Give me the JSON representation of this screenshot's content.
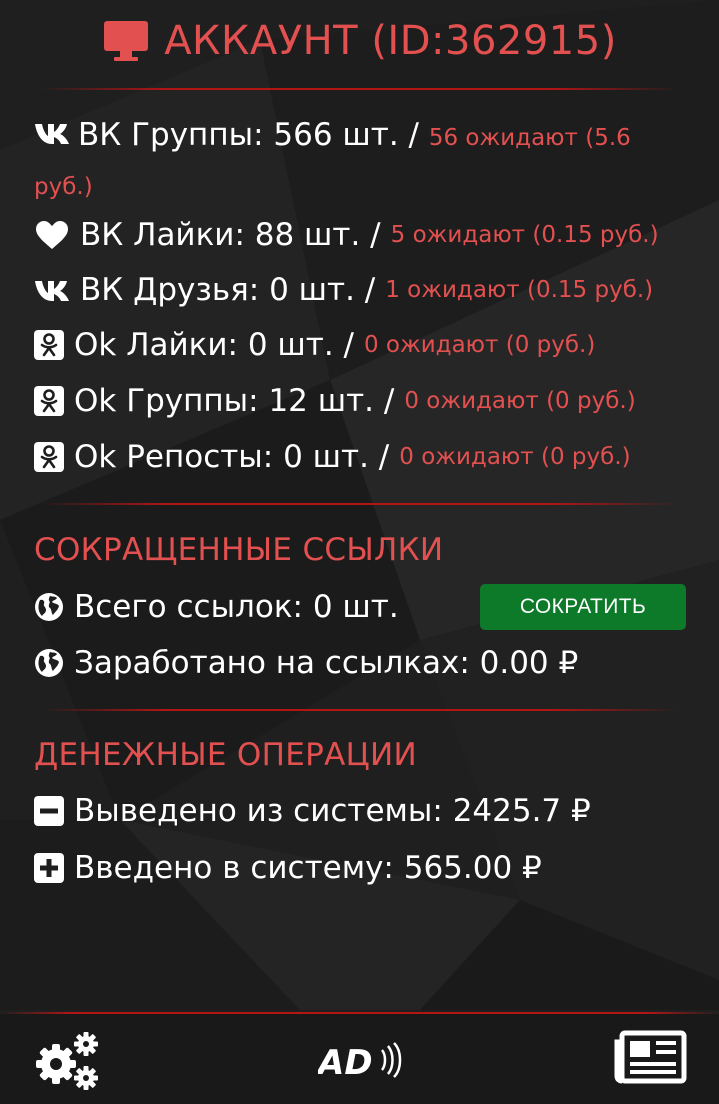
{
  "header": {
    "title": "АККАУНТ (ID:362915)",
    "icon": "monitor-icon"
  },
  "stats": {
    "vk_groups": {
      "label": "ВК Группы: 566 шт. /",
      "pending": "56 ожидают (5.6 руб.)",
      "icon": "vk-icon"
    },
    "vk_likes": {
      "label": "ВК Лайки: 88 шт. /",
      "pending": "5 ожидают (0.15 руб.)",
      "icon": "heart-icon"
    },
    "vk_friends": {
      "label": "ВК Друзья: 0 шт. /",
      "pending": "1 ожидают (0.15 руб.)",
      "icon": "vk-icon"
    },
    "ok_likes": {
      "label": "Ok Лайки: 0 шт. /",
      "pending": "0 ожидают (0 руб.)",
      "icon": "odnoklassniki-icon"
    },
    "ok_groups": {
      "label": "Ok Группы: 12 шт. /",
      "pending": "0 ожидают (0 руб.)",
      "icon": "odnoklassniki-icon"
    },
    "ok_reposts": {
      "label": "Ok Репосты: 0 шт. /",
      "pending": "0 ожидают (0 руб.)",
      "icon": "odnoklassniki-icon"
    }
  },
  "links": {
    "title": "СОКРАЩЕННЫЕ ССЫЛКИ",
    "total": "Всего ссылок: 0 шт.",
    "earned": "Заработано на ссылках: 0.00 ₽",
    "shorten_button": "СОКРАТИТЬ",
    "icon": "globe-icon"
  },
  "money": {
    "title": "ДЕНЕЖНЫЕ ОПЕРАЦИИ",
    "withdrawn": "Выведено из системы: 2425.7 ₽",
    "deposited": "Введено в систему: 565.00 ₽"
  },
  "footer": {
    "left_icon": "gears-icon",
    "center_logo": "AD",
    "right_icon": "newspaper-icon"
  },
  "colors": {
    "background": "#1e1e1e",
    "accent_red": "#e35050",
    "divider_red": "#b31515",
    "button_green": "#0d7a2a",
    "text": "#ffffff"
  }
}
